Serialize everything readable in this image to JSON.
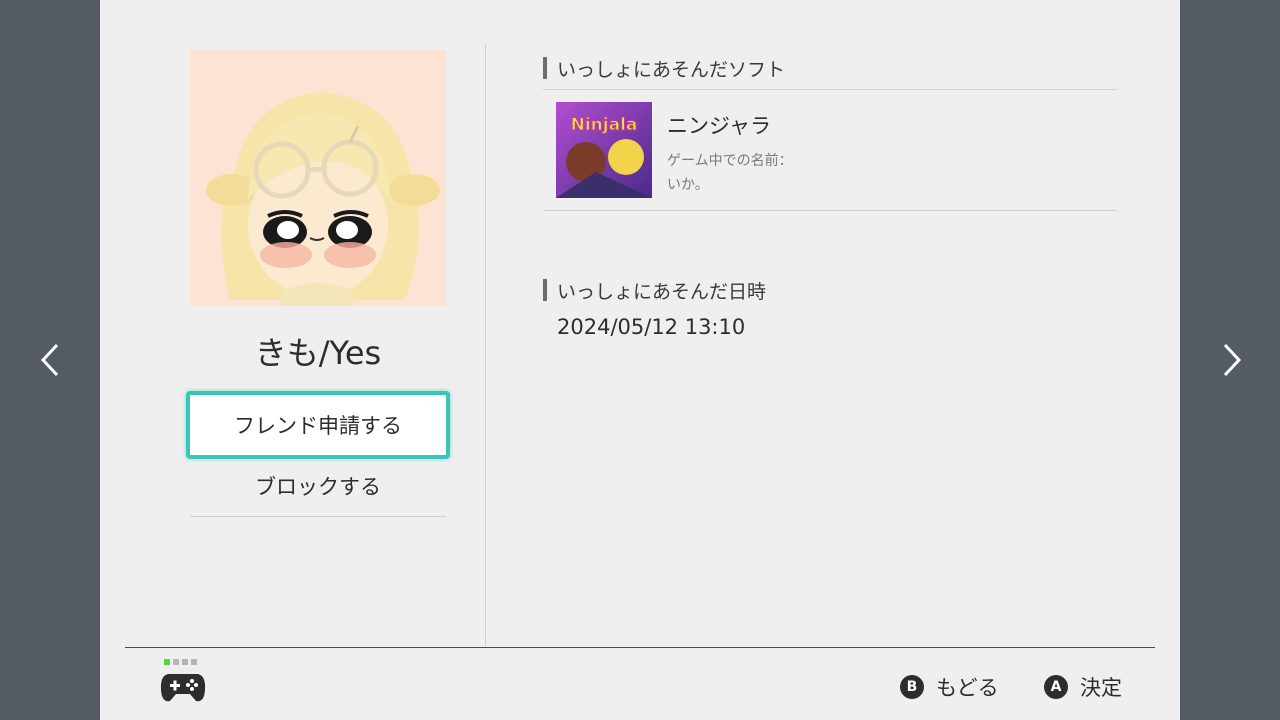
{
  "nav": {
    "left_icon": "chevron-left-icon",
    "right_icon": "chevron-right-icon"
  },
  "profile": {
    "username": "きも/Yes",
    "friend_request_label": "フレンド申請する",
    "block_label": "ブロックする"
  },
  "played_software": {
    "heading": "いっしょにあそんだソフト",
    "games": [
      {
        "title": "ニンジャラ",
        "in_game_name_label": "ゲーム中での名前：",
        "in_game_name": "いか。",
        "thumb_logo": "Ninjala"
      }
    ]
  },
  "played_date": {
    "heading": "いっしょにあそんだ日時",
    "value": "2024/05/12 13:10"
  },
  "footer": {
    "back_badge": "B",
    "back_label": "もどる",
    "confirm_badge": "A",
    "confirm_label": "決定"
  },
  "colors": {
    "accent": "#36c7b9",
    "player_indicator": "#5ad53b"
  }
}
